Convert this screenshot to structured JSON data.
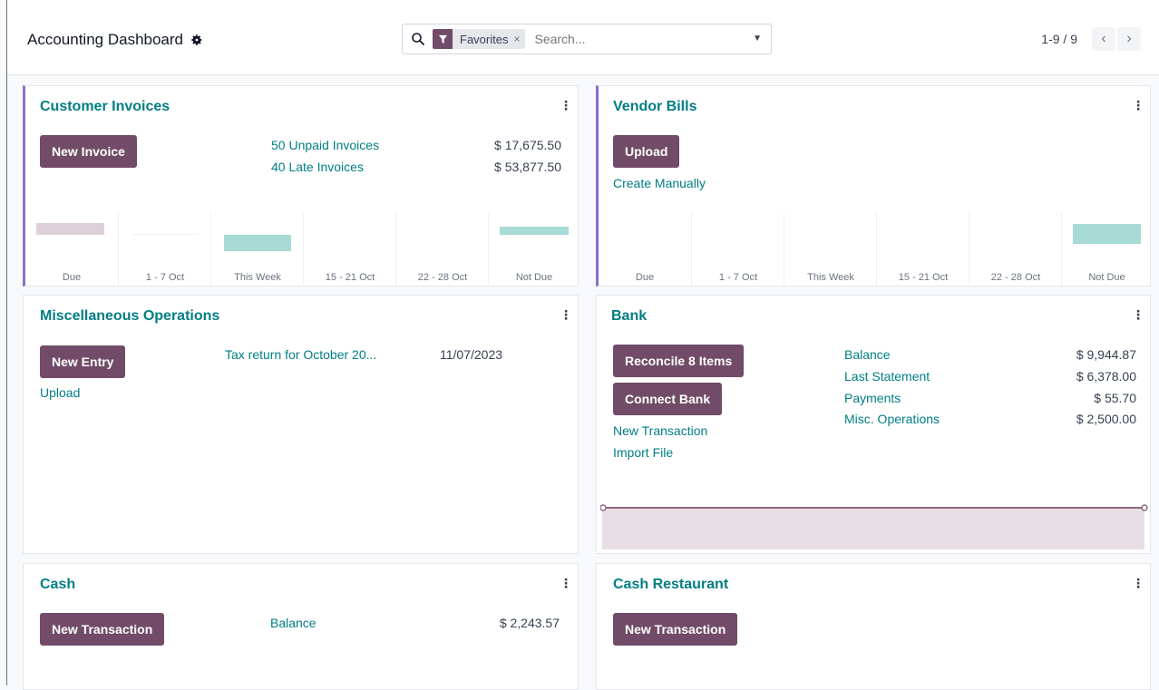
{
  "header": {
    "title": "Accounting Dashboard",
    "search": {
      "facet_label": "Favorites",
      "facet_remove": "×",
      "placeholder": "Search..."
    },
    "pager": {
      "value": "1-9 / 9",
      "prev": "‹",
      "next": "›"
    }
  },
  "colors": {
    "brand": "#714b67",
    "link": "#017e84",
    "bar_positive": "#a8dad6",
    "bar_past": "#ddd0d9",
    "bank_fill": "#e8dee5",
    "accent": "#8b6fc9"
  },
  "graph_labels": [
    "Due",
    "1 - 7 Oct",
    "This Week",
    "15 - 21 Oct",
    "22 - 28 Oct",
    "Not Due"
  ],
  "cards": {
    "customer_invoices": {
      "title": "Customer Invoices",
      "button": "New Invoice",
      "links": [
        {
          "label": "50 Unpaid Invoices",
          "amount": "$ 17,675.50"
        },
        {
          "label": "40 Late Invoices",
          "amount": "$ 53,877.50"
        }
      ]
    },
    "vendor_bills": {
      "title": "Vendor Bills",
      "button": "Upload",
      "link": "Create Manually"
    },
    "misc_operations": {
      "title": "Miscellaneous Operations",
      "button": "New Entry",
      "link": "Upload",
      "entry_label": "Tax return for October 20...",
      "entry_date": "11/07/2023"
    },
    "bank": {
      "title": "Bank",
      "buttons": [
        "Reconcile 8 Items",
        "Connect Bank"
      ],
      "links": [
        "New Transaction",
        "Import File"
      ],
      "rows": [
        {
          "label": "Balance",
          "amount": "$ 9,944.87"
        },
        {
          "label": "Last Statement",
          "amount": "$ 6,378.00"
        },
        {
          "label": "Payments",
          "amount": "$ 55.70"
        },
        {
          "label": "Misc. Operations",
          "amount": "$ 2,500.00"
        }
      ]
    },
    "cash": {
      "title": "Cash",
      "button": "New Transaction",
      "label": "Balance",
      "amount": "$ 2,243.57"
    },
    "cash_restaurant": {
      "title": "Cash Restaurant",
      "button": "New Transaction"
    }
  }
}
